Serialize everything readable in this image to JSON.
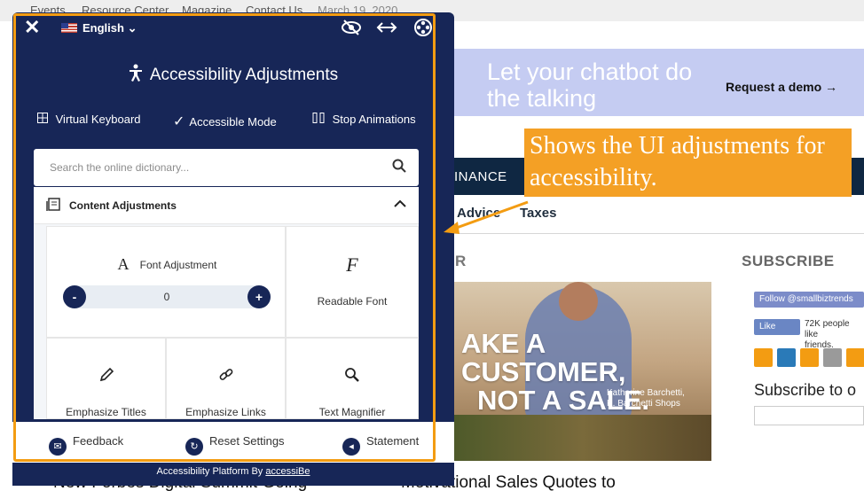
{
  "site": {
    "topnav": [
      "Events",
      "Resource Center",
      "Magazine",
      "Contact Us"
    ],
    "date": "March 19, 2020",
    "banner_text": "Let your chatbot do the talking",
    "banner_cta": "Request a demo →",
    "nav_label": "INANCE",
    "subnav": [
      "Advice",
      "Taxes"
    ],
    "section_letter": "R",
    "subscribe_heading": "SUBSCRIBE",
    "hero_line1": "AKE A CUSTOMER,",
    "hero_line2": "NOT A SALE.",
    "hero_credit_1": "Katherine Barchetti,",
    "hero_credit_2": "K. Barchetti Shops",
    "twitter_follow": "Follow @smallbiztrends",
    "fb_like": "Like",
    "fb_like_count": "72K people like",
    "fb_like_count_2": "friends.",
    "subscribe_to": "Subscribe to o",
    "bottom_left_title": "New Forbes Digital Summit Going",
    "bottom_right_title": "Motivational Sales Quotes to"
  },
  "panel": {
    "language": "English",
    "title": "Accessibility Adjustments",
    "modes": [
      "Virtual Keyboard",
      "Accessible Mode",
      "Stop Animations"
    ],
    "search_placeholder": "Search the online dictionary...",
    "content_section": "Content Adjustments",
    "tiles": {
      "font_adjustment": "Font Adjustment",
      "font_value": "0",
      "readable_font": "Readable Font",
      "emphasize_titles": "Emphasize Titles",
      "emphasize_links": "Emphasize Links",
      "text_magnifier": "Text Magnifier"
    },
    "footer": [
      "Feedback",
      "Reset Settings",
      "Statement"
    ],
    "platform_prefix": "Accessibility Platform By",
    "platform_brand": "accessiBe"
  },
  "callout_text": "Shows the UI adjustments for accessibility.",
  "colors": {
    "panel_bg": "#172657",
    "highlight": "#f39c12",
    "callout_bg": "#f4a025",
    "site_nav": "#0f2742",
    "banner": "#c5ccf2"
  },
  "icons": {
    "close": "close-icon",
    "flag": "us-flag-icon",
    "hide": "eye-slash-icon",
    "width": "arrows-horizontal-icon",
    "settings": "film-reel-icon",
    "accessibility": "accessibility-person-icon",
    "search": "search-icon"
  }
}
